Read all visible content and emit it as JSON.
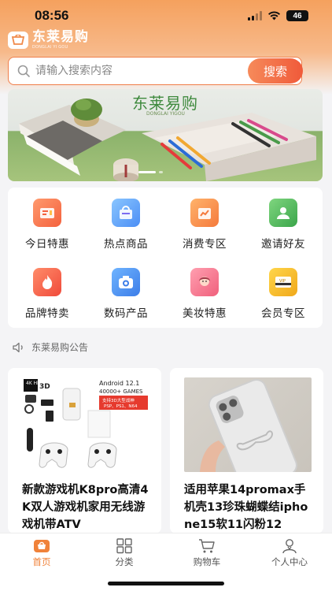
{
  "status_bar": {
    "time": "08:56",
    "battery": "46"
  },
  "brand": {
    "name": "东莱易购",
    "sub": "DONGLAI YI GOU"
  },
  "search": {
    "placeholder": "请输入搜索内容",
    "button_label": "搜索"
  },
  "banner": {
    "title": "东莱易购",
    "sub": "DONGLAI YIGOU"
  },
  "categories": [
    {
      "label": "今日特惠",
      "icon": "discount-icon"
    },
    {
      "label": "热点商品",
      "icon": "shopping-bag-icon"
    },
    {
      "label": "消费专区",
      "icon": "chart-bag-icon"
    },
    {
      "label": "邀请好友",
      "icon": "invite-friend-icon"
    },
    {
      "label": "品牌特卖",
      "icon": "flame-icon"
    },
    {
      "label": "数码产品",
      "icon": "camera-icon"
    },
    {
      "label": "美妆特惠",
      "icon": "beauty-portrait-icon"
    },
    {
      "label": "会员专区",
      "icon": "vip-card-icon"
    }
  ],
  "notice": {
    "text": "东莱易购公告"
  },
  "products": [
    {
      "title": "新款游戏机K8pro高清4K双人游戏机家用无线游戏机带ATV",
      "image_text": {
        "line1": "Android 12.1",
        "line2": "40000+ GAMES",
        "line3": "支持3D大型战神",
        "line4": "PSP、PS1、N64",
        "hdr": "4K HDR",
        "badge_3d": "3D"
      }
    },
    {
      "title": "适用苹果14promax手机壳13珍珠蝴蝶结iphone15软11闪粉12"
    }
  ],
  "tabbar": [
    {
      "label": "首页",
      "icon": "home-icon",
      "active": true
    },
    {
      "label": "分类",
      "icon": "grid-icon",
      "active": false
    },
    {
      "label": "购物车",
      "icon": "cart-icon",
      "active": false
    },
    {
      "label": "个人中心",
      "icon": "user-icon",
      "active": false
    }
  ],
  "colors": {
    "accent": "#f0823a",
    "search_border": "#f07e4a",
    "header_top": "#f5a15e"
  }
}
